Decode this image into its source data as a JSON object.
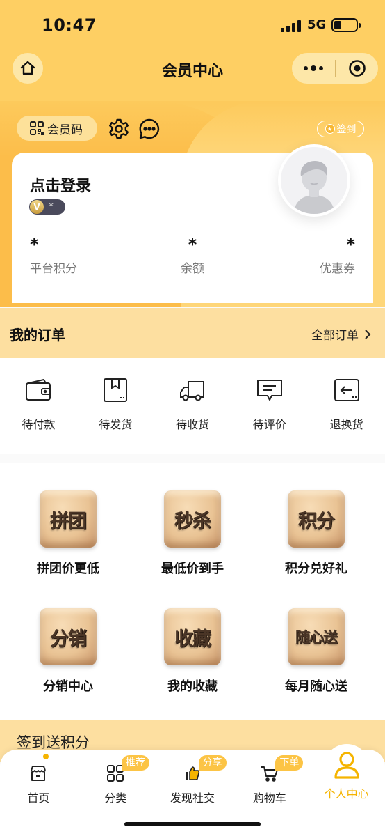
{
  "status_bar": {
    "time": "10:47",
    "network": "5G"
  },
  "nav": {
    "title": "会员中心"
  },
  "tools": {
    "member_code_label": "会员码",
    "checkin_label": "签到"
  },
  "profile": {
    "login_text": "点击登录",
    "level_value": "*",
    "stats": [
      {
        "value": "*",
        "label": "平台积分"
      },
      {
        "value": "*",
        "label": "余额"
      },
      {
        "value": "*",
        "label": "优惠券"
      }
    ]
  },
  "orders": {
    "title": "我的订单",
    "all_label": "全部订单",
    "items": [
      {
        "label": "待付款",
        "icon": "wallet-icon"
      },
      {
        "label": "待发货",
        "icon": "box-icon"
      },
      {
        "label": "待收货",
        "icon": "truck-icon"
      },
      {
        "label": "待评价",
        "icon": "comment-icon"
      },
      {
        "label": "退换货",
        "icon": "return-icon"
      }
    ]
  },
  "features": [
    {
      "tile": "拼团",
      "label": "拼团价更低"
    },
    {
      "tile": "秒杀",
      "label": "最低价到手"
    },
    {
      "tile": "积分",
      "label": "积分兑好礼"
    },
    {
      "tile": "分销",
      "label": "分销中心"
    },
    {
      "tile": "收藏",
      "label": "我的收藏"
    },
    {
      "tile": "随心送",
      "label": "每月随心送"
    }
  ],
  "checkin_section": {
    "title": "签到送积分"
  },
  "tab_bar": {
    "tabs": [
      {
        "label": "首页",
        "icon": "home-store-icon"
      },
      {
        "label": "分类",
        "icon": "grid-icon",
        "badge": "推荐"
      },
      {
        "label": "发现社交",
        "icon": "thumbs-up-icon",
        "badge": "分享"
      },
      {
        "label": "购物车",
        "icon": "cart-icon",
        "badge": "下单"
      },
      {
        "label": "个人中心",
        "icon": "person-icon"
      }
    ]
  },
  "colors": {
    "accent": "#fecf63",
    "active_tab": "#f5b400",
    "section_bg": "#fddfa0",
    "badge_bg": "#fcc445"
  }
}
